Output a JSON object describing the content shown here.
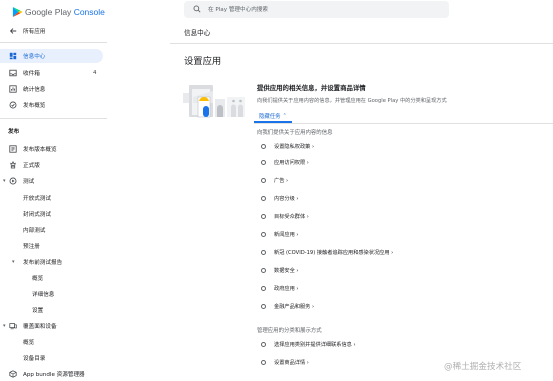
{
  "app": {
    "logo_text_1": "Google Play",
    "logo_text_2": "Console"
  },
  "sidebar": {
    "all_apps": "所有应用",
    "items": [
      {
        "label": "信息中心",
        "icon": "dashboard-icon",
        "active": true
      },
      {
        "label": "收件箱",
        "icon": "inbox-icon",
        "count": "4"
      },
      {
        "label": "统计信息",
        "icon": "stats-icon"
      },
      {
        "label": "发布概览",
        "icon": "publish-icon"
      }
    ],
    "release_section": "发布",
    "release_items": [
      {
        "label": "发布版本概览",
        "icon": "releases-icon"
      },
      {
        "label": "正式版",
        "icon": "production-icon"
      },
      {
        "label": "测试",
        "icon": "testing-icon"
      }
    ],
    "testing_sub": [
      "开放式测试",
      "封闭式测试",
      "内部测试",
      "预注册"
    ],
    "pre_launch": "发布前测试报告",
    "pre_launch_sub": [
      "概览",
      "详细信息",
      "设置"
    ],
    "devices": "覆盖面和设备",
    "devices_sub": [
      "概览",
      "设备目录"
    ],
    "bundle": "App bundle 资源管理器"
  },
  "search": {
    "placeholder": "在 Play 管理中心内搜索"
  },
  "header": {
    "breadcrumb": "信息中心",
    "page_title": "设置应用"
  },
  "setup": {
    "title": "提供应用的相关信息，并设置商品详情",
    "description": "向我们提供关于应用内容的信息，并管理应用在 Google Play 中的分类和呈现方式",
    "tab_label": "隐藏任务",
    "list_head_1": "向我们提供关于应用内容的信息",
    "tasks_1": [
      "设置隐私权政策",
      "应用访问权限",
      "广告",
      "内容分级",
      "目标受众群体",
      "新闻应用",
      "新冠 (COVID-19) 接触者追踪应用和感染状况应用",
      "数据安全",
      "政府应用",
      "金融产品和服务"
    ],
    "list_head_2": "管理应用的分类和展示方式",
    "tasks_2": [
      "选择应用类别并提供详细联系信息",
      "设置商品详情"
    ]
  },
  "watermark": "@稀土掘金技术社区",
  "colors": {
    "accent": "#1a73e8",
    "active_bg": "#e8f0fe",
    "text": "#202124",
    "muted": "#5f6368"
  }
}
